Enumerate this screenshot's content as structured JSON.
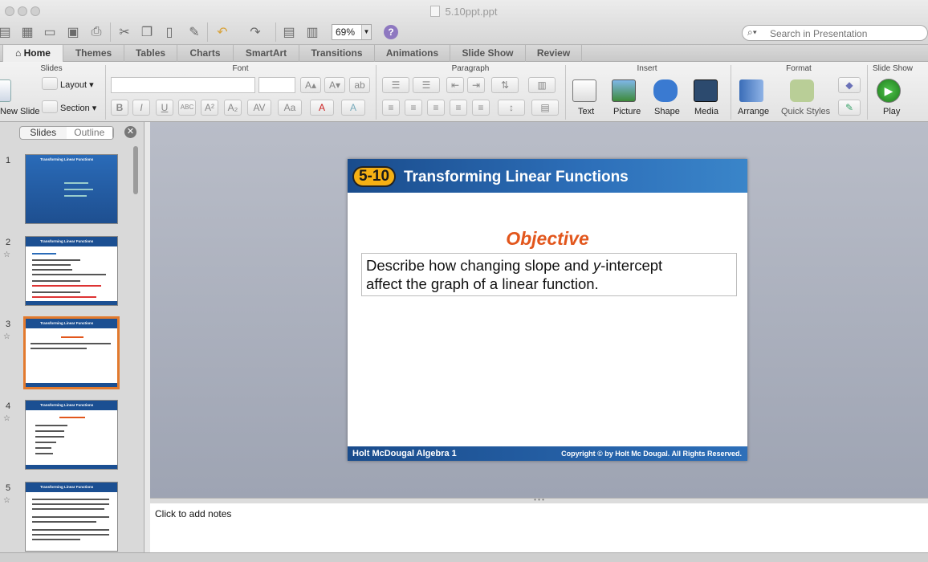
{
  "window": {
    "title": "5.10ppt.ppt"
  },
  "toolbar": {
    "zoom_value": "69%",
    "search_placeholder": "Search in Presentation"
  },
  "ribbon": {
    "tabs": [
      "Home",
      "Themes",
      "Tables",
      "Charts",
      "SmartArt",
      "Transitions",
      "Animations",
      "Slide Show",
      "Review"
    ],
    "groups": {
      "slides": "Slides",
      "font": "Font",
      "paragraph": "Paragraph",
      "insert": "Insert",
      "format": "Format",
      "slideshow": "Slide Show"
    },
    "buttons": {
      "new_slide": "New Slide",
      "layout": "Layout",
      "section": "Section",
      "text": "Text",
      "picture": "Picture",
      "shape": "Shape",
      "media": "Media",
      "arrange": "Arrange",
      "quick_styles": "Quick Styles",
      "play": "Play"
    }
  },
  "sidebar": {
    "segments": [
      "Slides",
      "Outline"
    ],
    "slides": [
      {
        "num": "1",
        "title": "Transforming Linear Functions"
      },
      {
        "num": "2",
        "title": "Transforming Linear Functions"
      },
      {
        "num": "3",
        "title": "Transforming Linear Functions"
      },
      {
        "num": "4",
        "title": "Transforming Linear Functions"
      },
      {
        "num": "5",
        "title": "Transforming Linear Functions"
      }
    ]
  },
  "slide": {
    "badge": "5-10",
    "title": "Transforming Linear Functions",
    "heading": "Objective",
    "body_line1_pre": "Describe how changing slope and ",
    "body_line1_ital": "y",
    "body_line1_post": "-intercept",
    "body_line2": "affect the graph of a linear function.",
    "footer_left": "Holt McDougal Algebra 1",
    "footer_right": "Copyright © by Holt Mc Dougal. All Rights Reserved."
  },
  "notes": {
    "placeholder": "Click to add notes"
  }
}
